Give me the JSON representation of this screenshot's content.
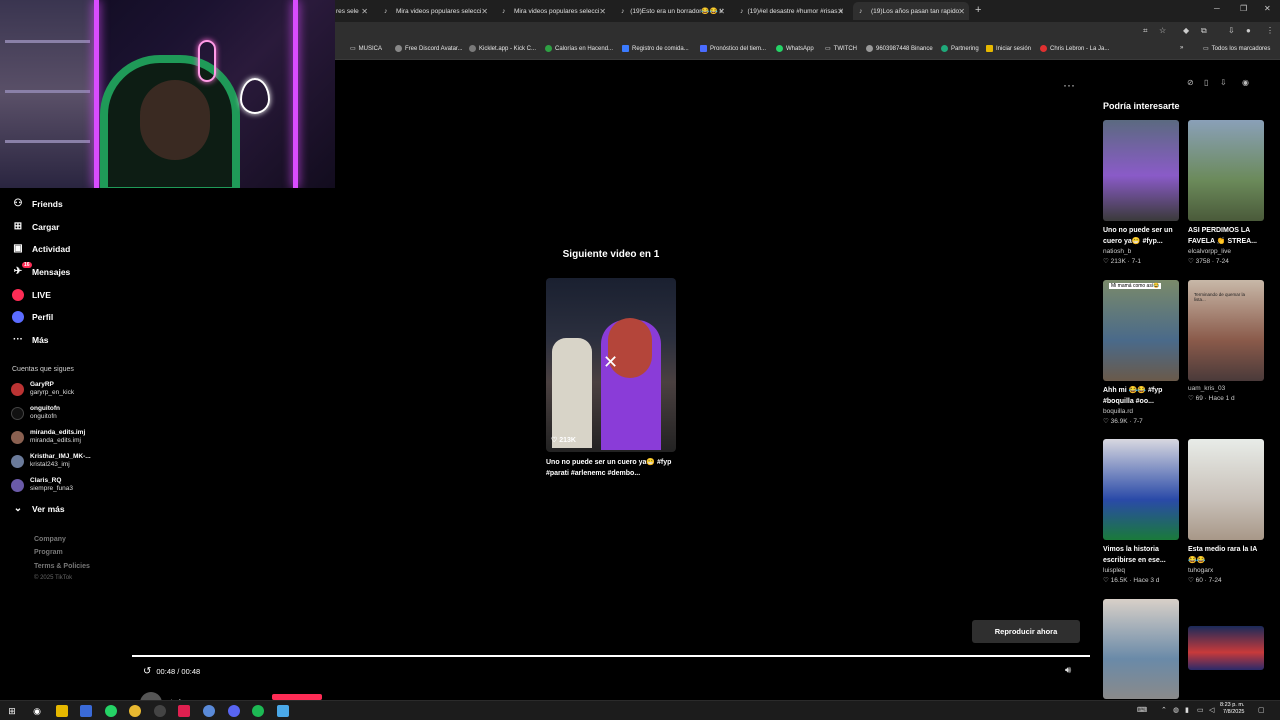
{
  "browser": {
    "tabs": [
      {
        "label": "res sele",
        "active": false
      },
      {
        "label": "Mira videos populares selecci",
        "active": false
      },
      {
        "label": "Mira videos populares selecci",
        "active": false
      },
      {
        "label": "(19)Esto era un borrador😂😂 #",
        "active": false
      },
      {
        "label": "(19)#el desastre #humor #risas #",
        "active": false
      },
      {
        "label": "(19)Los años pasan tan rapido",
        "active": true
      }
    ],
    "new_tab": "+",
    "bookmarks": [
      "MUSICA",
      "Free Discord Avatar...",
      "Kicklet.app - Kick C...",
      "Calorías en Hacend...",
      "Registro de comida...",
      "Pronóstico del tiem...",
      "WhatsApp",
      "TWITCH",
      "9603987448 Binance",
      "Partnering",
      "Iniciar sesión",
      "Chris Lebron - La Ja...",
      "Todos los marcadores"
    ]
  },
  "sidebar": {
    "nav": [
      {
        "label": "Friends",
        "icon": "friends-icon"
      },
      {
        "label": "Cargar",
        "icon": "upload-icon"
      },
      {
        "label": "Actividad",
        "icon": "activity-icon"
      },
      {
        "label": "Mensajes",
        "icon": "messages-icon",
        "badge": "16"
      },
      {
        "label": "LIVE",
        "icon": "live-icon"
      },
      {
        "label": "Perfil",
        "icon": "profile-icon"
      },
      {
        "label": "Más",
        "icon": "more-icon"
      }
    ],
    "following_title": "Cuentas que sigues",
    "accounts": [
      {
        "name": "GaryRP",
        "user": "garyrp_en_kick"
      },
      {
        "name": "onguitofn",
        "user": "onguitofn"
      },
      {
        "name": "miranda_edits.imj",
        "user": "miranda_edits.imj"
      },
      {
        "name": "Kristhar_IMJ_MK-...",
        "user": "kristal243_imj"
      },
      {
        "name": "Claris_RQ",
        "user": "siempre_funa3"
      }
    ],
    "see_more": "Ver más",
    "footer": [
      "Company",
      "Program",
      "Terms & Policies"
    ],
    "copyright": "© 2025 TikTok"
  },
  "player": {
    "next_title": "Siguiente video en 1",
    "next_video": {
      "likes": "213K",
      "caption": "Uno no puede ser un cuero ya😁 #fyp #parati #arlenemc #dembo..."
    },
    "play_now": "Reproducir ahora",
    "time": "00:48 / 00:48",
    "progress": 1.0,
    "author": "tuhogarx"
  },
  "recommendations": {
    "title": "Podría interesarte",
    "cards": [
      {
        "title": "Uno no puede ser un cuero ya😁 #fyp...",
        "author": "natiosh_b",
        "meta": "♡ 213K · 7-1"
      },
      {
        "title": "ASI PERDIMOS LA FAVELA 👏 STREA...",
        "author": "elcalvorpp_live",
        "meta": "♡ 3758 · 7-24"
      },
      {
        "title": "Ahh mi 😂😂 #fyp #boquilla #oo...",
        "author": "boquilla.rd",
        "meta": "♡ 36.9K · 7-7"
      },
      {
        "title": "",
        "author": "uam_kris_03",
        "meta": "♡ 69 · Hace 1 d"
      },
      {
        "title": "Vimos la historia escribirse en ese...",
        "author": "luispleq",
        "meta": "♡ 16.5K · Hace 3 d"
      },
      {
        "title": "Esta medio rara la IA 😂😂",
        "author": "tuhogarx",
        "meta": "♡ 60 · 7-24"
      },
      {
        "title": "",
        "author": "",
        "meta": ""
      },
      {
        "title": "",
        "author": "",
        "meta": ""
      }
    ],
    "overlay_1": "Mi mamá como así😂",
    "overlay_2": "Terminando de quemar la lista..."
  },
  "taskbar": {
    "clock_time": "8:23 p. m.",
    "clock_date": "7/8/2025"
  }
}
